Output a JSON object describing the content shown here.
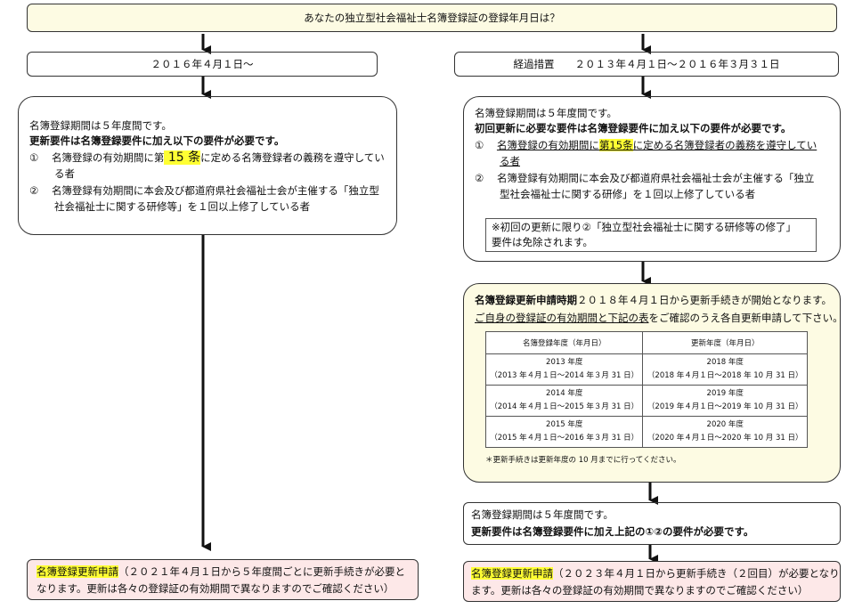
{
  "header": {
    "question": "あなたの独立型社会福祉士名簿登録証の登録年月日は？"
  },
  "left": {
    "period_label": "２０１６年４月１日〜",
    "info": {
      "line1": "名簿登録期間は５年度間です。",
      "line2": "更新要件は名簿登録要件に加え以下の要件が必要です。",
      "item1_num": "①",
      "item1_pre": "名簿登録の有効期間に第",
      "item1_hl": " 15 条",
      "item1_post": "に定める名簿登録者の義務を遵守してい",
      "item1_cont": "る者",
      "item2_num": "②",
      "item2_a": "名簿登録有効期間に本会及び都道府県社会福祉士会が主催する「独立型",
      "item2_b": "社会福祉士に関する研修等」を１回以上修了している者"
    },
    "result": {
      "hl": "名簿登録更新申請",
      "line1_rest": "（２０２１年４月１日から５年度間ごとに更新手続きが必要と",
      "line2": "なります。更新は各々の登録証の有効期間で異なりますのでご確認ください）"
    }
  },
  "right": {
    "period_label": "経過措置　　２０１３年４月１日〜２０１６年３月３１日",
    "info": {
      "line1": "名簿登録期間は５年度間です。",
      "line2": "初回更新に必要な要件は名簿登録要件に加え以下の要件が必要です。",
      "item1_num": "①",
      "item1_pre": "名簿登録の有効期間に",
      "item1_hl": "第15条",
      "item1_post": "に定める名簿登録者の義務を遵守してい",
      "item1_cont": "る者",
      "item2_num": "②",
      "item2_a": "名簿登録有効期間に本会及び都道府県社会福祉士会が主催する「独立",
      "item2_b": "型社会福祉士に関する研修」を１回以上修了している者",
      "note_a": "※初回の更新に限り②「独立型社会福祉士に関する研修等の修了」",
      "note_b": "要件は免除されます。"
    },
    "schedule": {
      "line1_bold": "名簿登録更新申請時期",
      "line1_rest": "２０１８年４月１日から更新手続きが開始となります。",
      "line2_u": "ご自身の登録証の有効期間と下記の表",
      "line2_rest": "をご確認のうえ各自更新申請して下さい。",
      "col_headers": [
        "名簿登録年度（年月日）",
        "更新年度（年月日）"
      ],
      "rows": [
        {
          "reg_year": "2013 年度",
          "reg_period": "（2013 年４月１日〜2014 年３月 31 日）",
          "renew_year": "2018 年度",
          "renew_period": "（2018 年４月１日〜2018 年 10 月 31 日）"
        },
        {
          "reg_year": "2014 年度",
          "reg_period": "（2014 年４月１日〜2015 年３月 31 日）",
          "renew_year": "2019 年度",
          "renew_period": "（2019 年４月１日〜2019 年 10 月 31 日）"
        },
        {
          "reg_year": "2015 年度",
          "reg_period": "（2015 年４月１日〜2016 年３月 31 日）",
          "renew_year": "2020 年度",
          "renew_period": "（2020 年４月１日〜2020 年 10 月 31 日）"
        }
      ],
      "footnote": "＊更新手続きは更新年度の 10 月までに行ってください。"
    },
    "after": {
      "line1": "名簿登録期間は５年度間です。",
      "line2": "更新要件は名簿登録要件に加え上記の①②の要件が必要です。"
    },
    "result": {
      "hl": "名簿登録更新申請",
      "line1_rest": "（２０２３年４月１日から更新手続き（２回目）が必要となり",
      "line2": "ます。更新は各々の登録証の有効期間で異なりますのでご確認ください）"
    }
  },
  "colors": {
    "highlight": "#ffff33",
    "cream": "#fdfbe3",
    "pink": "#fde8e8",
    "arrow_blue": "#3a78c9"
  }
}
